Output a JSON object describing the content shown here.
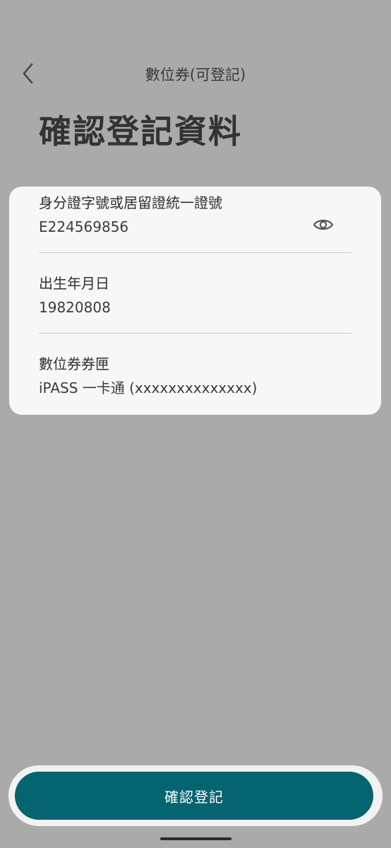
{
  "header": {
    "title": "數位券(可登記)",
    "back_icon": "chevron-left-icon"
  },
  "page": {
    "title": "確認登記資料"
  },
  "card": {
    "id_field": {
      "label": "身分證字號或居留證統一證號",
      "value": "E224569856",
      "toggle_icon": "eye-icon"
    },
    "birth_field": {
      "label": "出生年月日",
      "value": "19820808"
    },
    "wallet_field": {
      "label": "數位券券匣",
      "value": "iPASS 一卡通 (xxxxxxxxxxxxxx)"
    }
  },
  "footer": {
    "confirm_label": "確認登記"
  },
  "colors": {
    "background": "#a9aaa9",
    "card": "#f6f7f6",
    "primary_button": "#046470"
  }
}
